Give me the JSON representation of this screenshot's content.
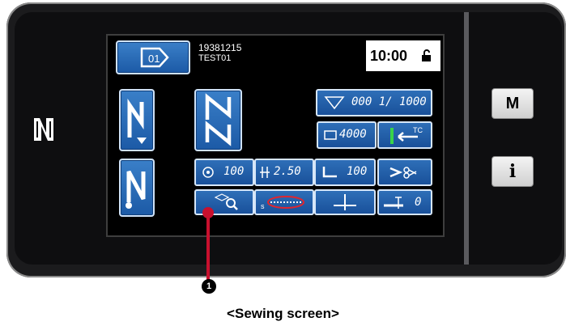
{
  "device": {
    "pattern_number": "19381215",
    "pattern_name": "TEST01",
    "clock": "10:00",
    "counter_value": "000 1/ 1000",
    "bobbin_counter": "4000",
    "tc_label": "TC",
    "speed": "100",
    "stitch_length": "2.50",
    "presser_value": "100",
    "needle_value": "0",
    "pattern_select_icon_number": "01",
    "feed_label": "s"
  },
  "side_panel": {
    "m_label": "M",
    "i_label": "i"
  },
  "callout": {
    "marker": "1"
  },
  "caption": "<Sewing screen>",
  "colors": {
    "button_blue": "#1c5aa6",
    "callout_red": "#c8102e",
    "screen_bg": "#000000"
  }
}
